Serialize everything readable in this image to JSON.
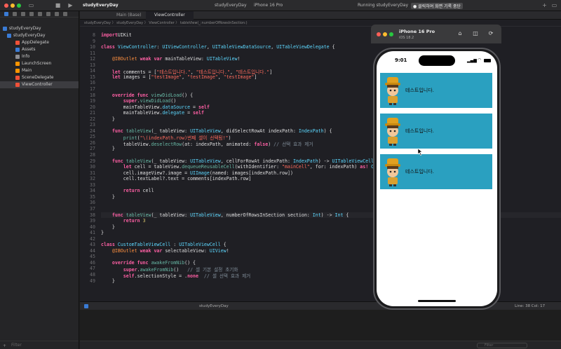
{
  "titlebar": {
    "project": "studyEveryDay",
    "breadcrumb_project": "studyEveryDay",
    "device": "iPhone 16 Pro",
    "run_status": "Running studyEveryDay on iPhone 16 Pro",
    "recording_label": "클릭하여 화면 기록 중단"
  },
  "navigator": {
    "items": [
      {
        "label": "studyEveryDay",
        "kind": "project"
      },
      {
        "label": "studyEveryDay",
        "kind": "folder"
      },
      {
        "label": "AppDelegate",
        "kind": "swift"
      },
      {
        "label": "Assets",
        "kind": "assets"
      },
      {
        "label": "Info",
        "kind": "plist"
      },
      {
        "label": "LaunchScreen",
        "kind": "storyboard"
      },
      {
        "label": "Main",
        "kind": "storyboard"
      },
      {
        "label": "SceneDelegate",
        "kind": "swift"
      },
      {
        "label": "ViewController",
        "kind": "swift"
      }
    ],
    "filter_placeholder": "Filter"
  },
  "editor": {
    "tabs": [
      "Main (Base)",
      "ViewController"
    ],
    "jumpbar": "studyEveryDay 〉 studyEveryDay 〉 ViewController 〉 tableView(_:numberOfRowsInSection:)",
    "status_target": "studyEveryDay",
    "cursor_position": "Line: 38  Col: 17",
    "filter_placeholder": "Filter"
  },
  "code_lines": [
    {
      "n": "8",
      "t": [
        [
          "kw",
          "import"
        ],
        [
          "",
          "UIKit"
        ]
      ]
    },
    {
      "n": "9",
      "t": [
        [
          "",
          ""
        ]
      ]
    },
    {
      "n": "10",
      "t": [
        [
          "kw",
          "class"
        ],
        [
          "",
          " "
        ],
        [
          "ty",
          "ViewController"
        ],
        [
          "",
          ": "
        ],
        [
          "ty",
          "UIViewController"
        ],
        [
          "",
          ", "
        ],
        [
          "ty",
          "UITableViewDataSource"
        ],
        [
          "",
          ", "
        ],
        [
          "ty",
          "UITableViewDelegate"
        ],
        [
          "",
          " {"
        ]
      ]
    },
    {
      "n": "11",
      "t": [
        [
          "",
          ""
        ]
      ]
    },
    {
      "n": "12",
      "t": [
        [
          "at",
          "    @IBOutlet"
        ],
        [
          "",
          " "
        ],
        [
          "kw",
          "weak var"
        ],
        [
          "",
          " mainTableView: "
        ],
        [
          "ty",
          "UITableView"
        ],
        [
          "",
          "!"
        ]
      ]
    },
    {
      "n": "13",
      "t": [
        [
          "",
          ""
        ]
      ]
    },
    {
      "n": "14",
      "t": [
        [
          "kw",
          "    let"
        ],
        [
          "",
          " comments = ["
        ],
        [
          "st",
          "\"테스트입니다.\""
        ],
        [
          "",
          ", "
        ],
        [
          "st",
          "\"테스트입니다.\""
        ],
        [
          "",
          ", "
        ],
        [
          "st",
          "\"테스트입니다.\""
        ],
        [
          "",
          "]"
        ]
      ]
    },
    {
      "n": "15",
      "t": [
        [
          "kw",
          "    let"
        ],
        [
          "",
          " images = ["
        ],
        [
          "st",
          "\"testImage\""
        ],
        [
          "",
          ", "
        ],
        [
          "st",
          "\"testImage\""
        ],
        [
          "",
          ", "
        ],
        [
          "st",
          "\"testImage\""
        ],
        [
          "",
          "]"
        ]
      ]
    },
    {
      "n": "16",
      "t": [
        [
          "",
          ""
        ]
      ]
    },
    {
      "n": "17",
      "t": [
        [
          "",
          ""
        ]
      ]
    },
    {
      "n": "18",
      "t": [
        [
          "kw",
          "    override func"
        ],
        [
          "",
          " "
        ],
        [
          "fn",
          "viewDidLoad"
        ],
        [
          "",
          "() {"
        ]
      ]
    },
    {
      "n": "19",
      "t": [
        [
          "kw",
          "        super"
        ],
        [
          "",
          "."
        ],
        [
          "fn",
          "viewDidLoad"
        ],
        [
          "",
          "()"
        ]
      ]
    },
    {
      "n": "20",
      "t": [
        [
          "",
          "        mainTableView."
        ],
        [
          "ty",
          "dataSource"
        ],
        [
          "",
          " = "
        ],
        [
          "kw",
          "self"
        ]
      ]
    },
    {
      "n": "21",
      "t": [
        [
          "",
          "        mainTableView."
        ],
        [
          "ty",
          "delegate"
        ],
        [
          "",
          " = "
        ],
        [
          "kw",
          "self"
        ]
      ]
    },
    {
      "n": "22",
      "t": [
        [
          "",
          "    }"
        ]
      ]
    },
    {
      "n": "23",
      "t": [
        [
          "",
          ""
        ]
      ]
    },
    {
      "n": "24",
      "t": [
        [
          "kw",
          "    func"
        ],
        [
          "",
          " "
        ],
        [
          "fn",
          "tableView"
        ],
        [
          "",
          "(_ tableView: "
        ],
        [
          "ty",
          "UITableView"
        ],
        [
          "",
          ", didSelectRowAt indexPath: "
        ],
        [
          "ty",
          "IndexPath"
        ],
        [
          "",
          ") {"
        ]
      ]
    },
    {
      "n": "25",
      "t": [
        [
          "fn",
          "        print"
        ],
        [
          "",
          "("
        ],
        [
          "st",
          "\"\\(indexPath.row)번째 셀이 선택됨!\""
        ],
        [
          "",
          ")"
        ]
      ]
    },
    {
      "n": "26",
      "t": [
        [
          "",
          "        tableView."
        ],
        [
          "fn",
          "deselectRow"
        ],
        [
          "",
          "(at: indexPath, animated: "
        ],
        [
          "kw",
          "false"
        ],
        [
          "",
          ") "
        ],
        [
          "cm",
          "// 선택 효과 제거"
        ]
      ]
    },
    {
      "n": "27",
      "t": [
        [
          "",
          "    }"
        ]
      ]
    },
    {
      "n": "28",
      "t": [
        [
          "",
          ""
        ]
      ]
    },
    {
      "n": "29",
      "t": [
        [
          "kw",
          "    func"
        ],
        [
          "",
          " "
        ],
        [
          "fn",
          "tableView"
        ],
        [
          "",
          "(_ tableView: "
        ],
        [
          "ty",
          "UITableView"
        ],
        [
          "",
          ", cellForRowAt indexPath: "
        ],
        [
          "ty",
          "IndexPath"
        ],
        [
          "",
          ") -> "
        ],
        [
          "ty",
          "UITableViewCell"
        ],
        [
          "",
          " {"
        ]
      ]
    },
    {
      "n": "30",
      "t": [
        [
          "kw",
          "        let"
        ],
        [
          "",
          " cell = tableView."
        ],
        [
          "fn",
          "dequeueReusableCell"
        ],
        [
          "",
          "(withIdentifier: "
        ],
        [
          "st",
          "\"mainCell\""
        ],
        [
          "",
          ", for: indexPath) "
        ],
        [
          "kw",
          "as!"
        ],
        [
          "",
          " "
        ],
        [
          "ty",
          "CustomTableViewCell"
        ]
      ]
    },
    {
      "n": "31",
      "t": [
        [
          "",
          "        cell.imageView?.image = "
        ],
        [
          "ty",
          "UIImage"
        ],
        [
          "",
          "(named: images[indexPath.row])"
        ]
      ]
    },
    {
      "n": "32",
      "t": [
        [
          "",
          "        cell.textLabel?.text = comments[indexPath.row]"
        ]
      ]
    },
    {
      "n": "33",
      "t": [
        [
          "",
          ""
        ]
      ]
    },
    {
      "n": "34",
      "t": [
        [
          "kw",
          "        return"
        ],
        [
          "",
          " cell"
        ]
      ]
    },
    {
      "n": "35",
      "t": [
        [
          "",
          "    }"
        ]
      ]
    },
    {
      "n": "36",
      "t": [
        [
          "",
          ""
        ]
      ]
    },
    {
      "n": "37",
      "t": [
        [
          "",
          ""
        ]
      ]
    },
    {
      "n": "38",
      "t": [
        [
          "kw",
          "    func"
        ],
        [
          "",
          " "
        ],
        [
          "fn",
          "tableView"
        ],
        [
          "",
          "(_ tableView: "
        ],
        [
          "ty",
          "UITableView"
        ],
        [
          "",
          ", numberOfRowsInSection section: "
        ],
        [
          "ty",
          "Int"
        ],
        [
          "",
          ") -> "
        ],
        [
          "ty",
          "Int"
        ],
        [
          "",
          " {"
        ]
      ]
    },
    {
      "n": "39",
      "t": [
        [
          "kw",
          "        return"
        ],
        [
          "",
          " "
        ],
        [
          "nm",
          "3"
        ]
      ]
    },
    {
      "n": "40",
      "t": [
        [
          "",
          "    }"
        ]
      ]
    },
    {
      "n": "41",
      "t": [
        [
          "",
          "}"
        ]
      ]
    },
    {
      "n": "42",
      "t": [
        [
          "",
          ""
        ]
      ]
    },
    {
      "n": "43",
      "t": [
        [
          "kw",
          "class"
        ],
        [
          "",
          " "
        ],
        [
          "ty",
          "CustomTableViewCell"
        ],
        [
          "",
          " : "
        ],
        [
          "ty",
          "UITableViewCell"
        ],
        [
          "",
          " {"
        ]
      ]
    },
    {
      "n": "44",
      "t": [
        [
          "at",
          "    @IBOutlet"
        ],
        [
          "",
          " "
        ],
        [
          "kw",
          "weak var"
        ],
        [
          "",
          " selectableView: "
        ],
        [
          "ty",
          "UIView"
        ],
        [
          "",
          "!"
        ]
      ]
    },
    {
      "n": "45",
      "t": [
        [
          "",
          ""
        ]
      ]
    },
    {
      "n": "46",
      "t": [
        [
          "kw",
          "    override func"
        ],
        [
          "",
          " "
        ],
        [
          "fn",
          "awakeFromNib"
        ],
        [
          "",
          "() {"
        ]
      ]
    },
    {
      "n": "47",
      "t": [
        [
          "kw",
          "        super"
        ],
        [
          "",
          "."
        ],
        [
          "fn",
          "awakeFromNib"
        ],
        [
          "",
          "()   "
        ],
        [
          "cm",
          "// 셀 기본 설정 초기화"
        ]
      ]
    },
    {
      "n": "48",
      "t": [
        [
          "kw",
          "        self"
        ],
        [
          "",
          ".selectionStyle = ."
        ],
        [
          "kw",
          "none"
        ],
        [
          "",
          "  "
        ],
        [
          "cm",
          "// 셀 선택 효과 제거"
        ]
      ]
    },
    {
      "n": "49",
      "t": [
        [
          "",
          "    }"
        ]
      ]
    }
  ],
  "simulator": {
    "device_name": "iPhone 16 Pro",
    "os_version": "iOS 18.2",
    "time": "9:01",
    "cells": [
      {
        "text": "테스트입니다."
      },
      {
        "text": "테스트입니다."
      },
      {
        "text": "테스트입니다."
      }
    ]
  },
  "colors": {
    "cell_background": "#2aa0c0",
    "editor_background": "#1f1f24"
  }
}
